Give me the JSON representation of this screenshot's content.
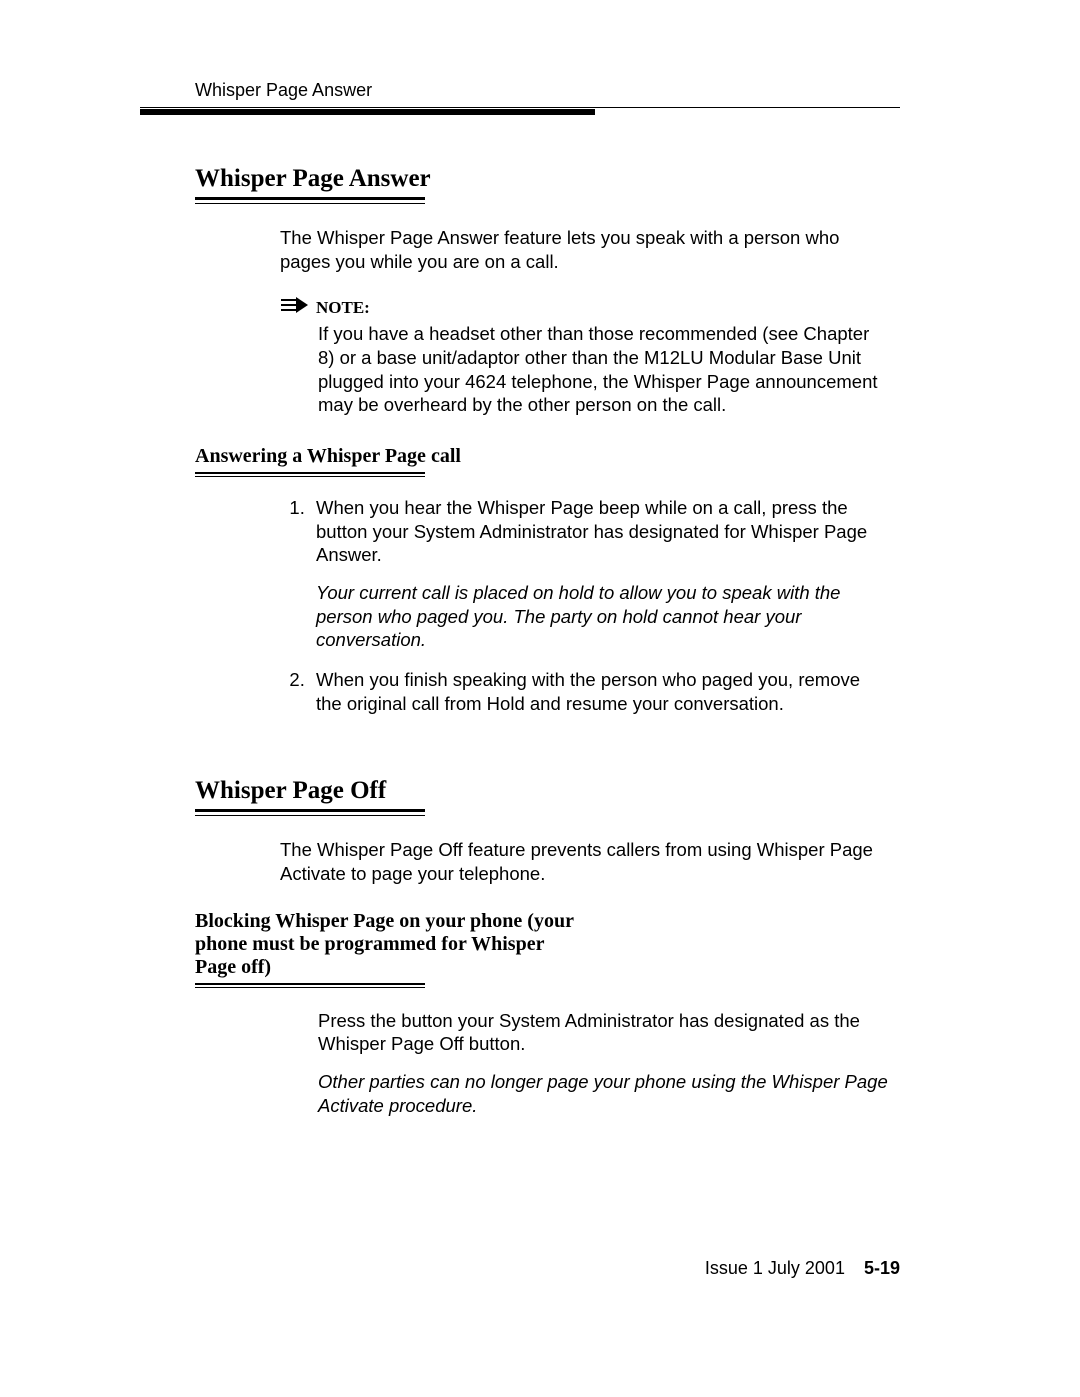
{
  "header": {
    "running": "Whisper Page Answer"
  },
  "section1": {
    "title": "Whisper Page Answer",
    "intro": "The Whisper Page Answer feature lets you speak with a person who pages you while you are on a call.",
    "note": {
      "label": "NOTE:",
      "body": "If you have a headset other than those recommended (see Chapter 8) or a base unit/adaptor other than the M12LU Modular Base Unit plugged into your 4624 telephone, the Whisper Page announcement may be overheard by the other person on the call."
    },
    "sub": {
      "title": "Answering a Whisper Page call",
      "steps": [
        {
          "text": "When you hear the Whisper Page beep while on a call, press the button your System Administrator has designated for Whisper Page Answer.",
          "result": "Your current call is placed on hold to allow you to speak with the person who paged you. The party on hold cannot hear your conversation."
        },
        {
          "text": "When you finish speaking with the person who paged you, remove the original call from Hold and resume your conversation."
        }
      ]
    }
  },
  "section2": {
    "title": "Whisper Page Off",
    "intro": "The Whisper Page Off feature prevents callers from using Whisper Page Activate to page your telephone.",
    "sub": {
      "title": "Blocking Whisper Page on your phone (your phone must be programmed for Whisper Page off)",
      "step": "Press the button your System Administrator has designated as the Whisper Page Off button.",
      "result": "Other parties can no longer page your phone using the Whisper Page Activate procedure."
    }
  },
  "footer": {
    "issue": "Issue  1   July 2001",
    "page": "5-19"
  }
}
